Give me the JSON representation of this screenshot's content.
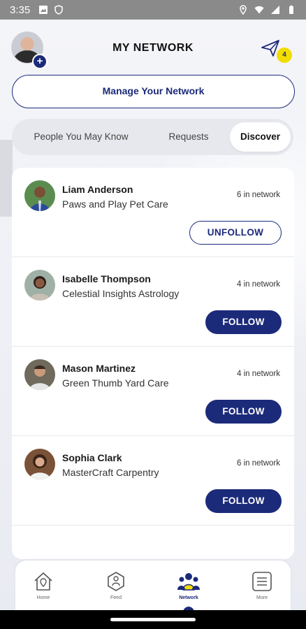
{
  "status_bar": {
    "time": "3:35",
    "icons": [
      "photo-icon",
      "shield-icon",
      "location-icon",
      "wifi-icon",
      "signal-icon",
      "battery-icon"
    ]
  },
  "header": {
    "title": "MY NETWORK",
    "badge_count": "4",
    "icons": [
      "avatar-plus-icon",
      "send-icon"
    ]
  },
  "manage_button": {
    "label": "Manage Your Network"
  },
  "tabs": [
    {
      "label": "People You May Know",
      "active": false
    },
    {
      "label": "Requests",
      "active": false
    },
    {
      "label": "Discover",
      "active": true
    }
  ],
  "people": [
    {
      "name": "Liam Anderson",
      "company": "Paws and Play Pet Care",
      "network": "6 in network",
      "action": "UNFOLLOW"
    },
    {
      "name": "Isabelle Thompson",
      "company": "Celestial Insights Astrology",
      "network": "4 in network",
      "action": "FOLLOW"
    },
    {
      "name": "Mason Martinez",
      "company": "Green Thumb Yard Care",
      "network": "4 in network",
      "action": "FOLLOW"
    },
    {
      "name": "Sophia Clark",
      "company": "MasterCraft Carpentry",
      "network": "6 in network",
      "action": "FOLLOW"
    }
  ],
  "bottom_nav": [
    {
      "label": "Home",
      "icon": "home-icon",
      "active": false
    },
    {
      "label": "Feed",
      "icon": "feed-icon",
      "active": false
    },
    {
      "label": "Network",
      "icon": "network-icon",
      "active": true
    },
    {
      "label": "More",
      "icon": "menu-icon",
      "active": false
    }
  ],
  "colors": {
    "brand": "#1c2a7a",
    "badge": "#f2dd00",
    "status_bar": "#8a8a8a"
  }
}
